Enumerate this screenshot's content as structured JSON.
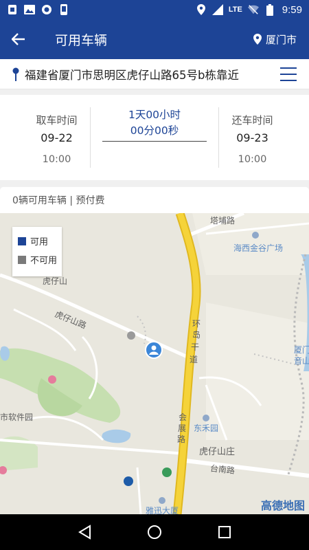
{
  "status_bar": {
    "network": "LTE",
    "battery": "8",
    "time": "9:59"
  },
  "app_bar": {
    "title": "可用车辆",
    "city": "厦门市"
  },
  "address": {
    "text": "福建省厦门市思明区虎仔山路65号b栋靠近"
  },
  "rental_time": {
    "pickup_label": "取车时间",
    "pickup_date": "09-22",
    "pickup_time": "10:00",
    "duration_line1": "1天00小时",
    "duration_line2": "00分00秒",
    "return_label": "还车时间",
    "return_date": "09-23",
    "return_time": "10:00"
  },
  "summary": {
    "text": "0辆可用车辆 | 预付费"
  },
  "map": {
    "legend": {
      "available": "可用",
      "unavailable": "不可用"
    },
    "labels": {
      "tabu_road": "塔埔路",
      "haixi": "海西金谷广场",
      "huzaishan": "虎仔山",
      "huzaishan_road": "虎仔山路",
      "ring_road_1": "环",
      "ring_road_2": "岛",
      "ring_road_3": "干",
      "ring_road_4": "道",
      "xiamen_1": "厦门",
      "xiamen_2": "音山",
      "software_park": "市软件园",
      "huizhan_1": "会",
      "huizhan_2": "展",
      "huizhan_3": "路",
      "donghe": "东禾园",
      "huzaishan_village": "虎仔山庄",
      "tainan_road": "台南路",
      "yaxun": "雅迅大厦",
      "logo": "高德地图"
    },
    "colors": {
      "available": "#1d4496",
      "unavailable": "#7a7a7a",
      "main_road": "#f5d33a"
    }
  },
  "colors": {
    "brand": "#1d4496"
  }
}
